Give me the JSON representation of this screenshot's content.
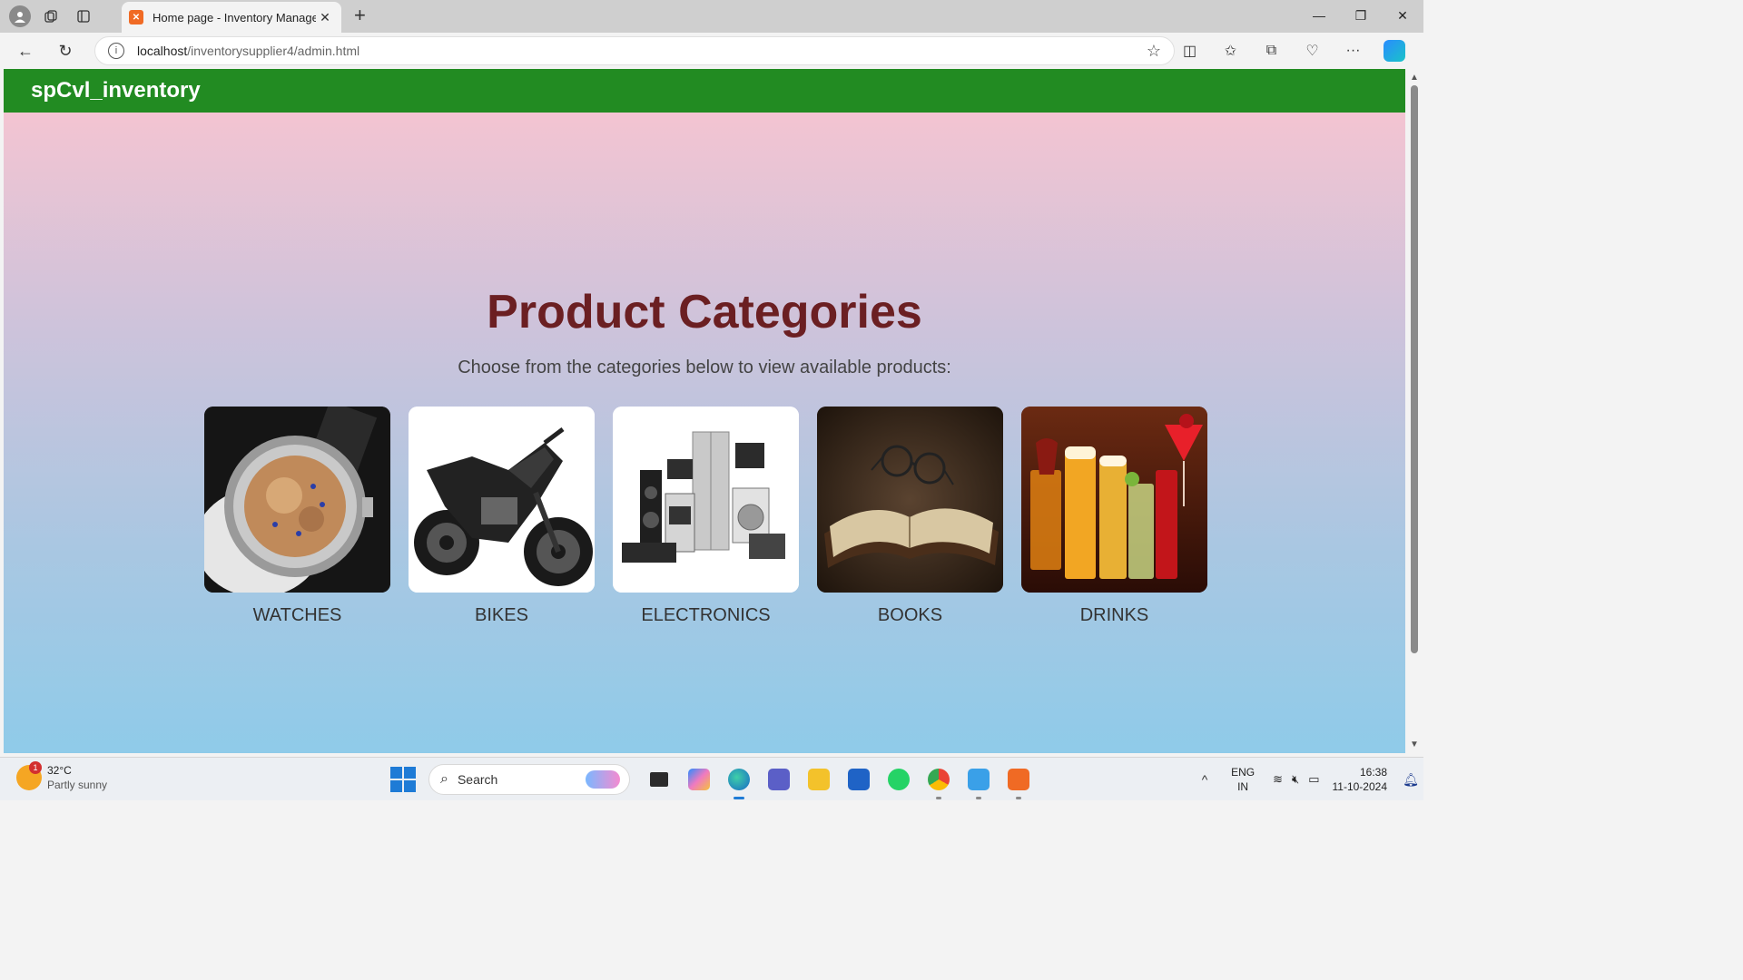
{
  "browser": {
    "tab_title": "Home page - Inventory Managem",
    "url_host": "localhost",
    "url_path": "/inventorysupplier4/admin.html",
    "favicon_icon": "xampp-icon"
  },
  "site": {
    "brand": "spCvl_inventory",
    "header_color": "#228b22"
  },
  "main": {
    "title": "Product Categories",
    "subtitle": "Choose from the categories below to view available products:",
    "categories": [
      {
        "label": "WATCHES",
        "image": "watch-image"
      },
      {
        "label": "BIKES",
        "image": "motorcycle-image"
      },
      {
        "label": "ELECTRONICS",
        "image": "appliances-image"
      },
      {
        "label": "BOOKS",
        "image": "book-image"
      },
      {
        "label": "DRINKS",
        "image": "cocktails-image"
      }
    ]
  },
  "taskbar": {
    "weather_temp": "32°C",
    "weather_cond": "Partly sunny",
    "weather_badge": "1",
    "search_placeholder": "Search",
    "lang_top": "ENG",
    "lang_bottom": "IN",
    "time": "16:38",
    "date": "11-10-2024"
  }
}
